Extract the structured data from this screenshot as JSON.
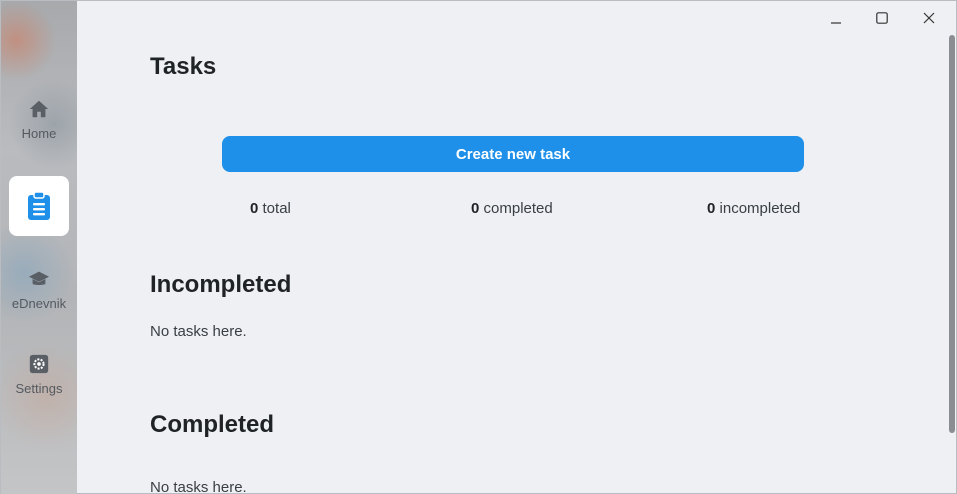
{
  "sidebar": {
    "items": [
      {
        "label": "Home",
        "icon": "home-icon"
      },
      {
        "label": "",
        "icon": "clipboard-icon",
        "active": true
      },
      {
        "label": "eDnevnik",
        "icon": "graduation-cap-icon"
      },
      {
        "label": "Settings",
        "icon": "gear-icon"
      }
    ]
  },
  "window_controls": {
    "minimize": "minimize-icon",
    "maximize": "maximize-icon",
    "close": "close-icon"
  },
  "main": {
    "title": "Tasks",
    "create_button": "Create new task",
    "stats": {
      "total_count": "0",
      "total_label": "total",
      "completed_count": "0",
      "completed_label": "completed",
      "incompleted_count": "0",
      "incompleted_label": "incompleted"
    },
    "sections": {
      "incompleted_title": "Incompleted",
      "incompleted_empty": "No tasks here.",
      "completed_title": "Completed",
      "completed_empty": "No tasks here."
    }
  },
  "colors": {
    "accent": "#1e90ea",
    "background": "#eef0f3",
    "text": "#1f2326"
  }
}
